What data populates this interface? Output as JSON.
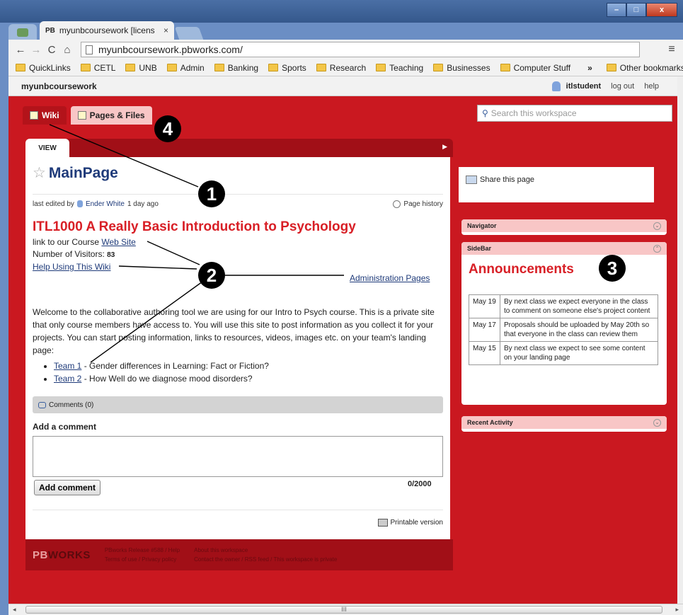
{
  "browser": {
    "tab_title": "myunbcoursework [licens",
    "tab_favicon_text": "PB",
    "tab_close": "×",
    "url": "myunbcoursework.pbworks.com/",
    "win_min": "–",
    "win_max": "□",
    "win_close": "x",
    "back": "←",
    "forward": "→",
    "reload": "C",
    "home": "⌂",
    "menu": "≡",
    "bookmarks": [
      "QuickLinks",
      "CETL",
      "UNB",
      "Admin",
      "Banking",
      "Sports",
      "Research",
      "Teaching",
      "Businesses",
      "Computer Stuff"
    ],
    "bookmarks_overflow": "»",
    "other_bookmarks": "Other bookmarks",
    "hscroll_grip": "III"
  },
  "pb_header": {
    "workspace": "myunbcoursework",
    "username": "itlstudent",
    "logout": "log out",
    "help": "help"
  },
  "nav_tabs": {
    "wiki": "Wiki",
    "pages_files": "Pages & Files"
  },
  "search": {
    "placeholder": "Search this workspace"
  },
  "view_tab": "VIEW",
  "page": {
    "star": "☆",
    "title": "MainPage",
    "meta_prefix": "last edited by",
    "editor": "Ender White",
    "edited_ago": "1 day ago",
    "history": "Page history",
    "heading": "ITL1000 A Really Basic Introduction to Psychology",
    "course_prefix": "link to our Course",
    "course_link": "Web Site",
    "visitors_label": "Number of Visitors:",
    "visitors_count": "83",
    "help_link": "Help Using This Wiki",
    "admin_link": "Administration Pages",
    "welcome": "Welcome to the collaborative authoring tool we are using for our  Intro to Psych course.  This is a private site that only course members have access to.  You will use this site to post information as you collect it for your projects.  You can start posting information, links to resources, videos, images etc.  on your team's landing page:",
    "teams": [
      {
        "link": "Team 1",
        "desc": " - Gender differences in Learning:  Fact or Fiction?"
      },
      {
        "link": "Team 2",
        "desc": "  - How Well do we diagnose mood disorders?"
      }
    ],
    "comments_label": "Comments (0)",
    "add_comment_heading": "Add a comment",
    "counter": "0/2000",
    "add_comment_button": "Add comment",
    "printable": "Printable version"
  },
  "footer": {
    "logo_pb": "PB",
    "logo_works": "WORKS",
    "release": "PBworks Release #588 / Help",
    "terms": "Terms of use / Privacy policy",
    "about": "About this workspace",
    "contact": "Contact the owner / RSS feed / This workspace is private"
  },
  "sidebar": {
    "share": "Share this page",
    "navigator": "Navigator",
    "sidebar_title": "SideBar",
    "announcements": "Announcements",
    "items": [
      {
        "date": "May 19",
        "text": "By next class we expect everyone in the class to comment on someone else's project content"
      },
      {
        "date": "May 17",
        "text": "Proposals should be uploaded by May 20th so that everyone in the class can review them"
      },
      {
        "date": "May 15",
        "text": "By next class we expect to see some content on your landing page"
      }
    ],
    "recent_activity": "Recent Activity",
    "toggle_down": "⌄",
    "toggle_up": "⌃"
  },
  "callouts": [
    "1",
    "2",
    "3",
    "4"
  ],
  "colors": {
    "brand_red": "#ca1820",
    "title_blue": "#1f3b7a",
    "heading_red": "#d81f26"
  }
}
